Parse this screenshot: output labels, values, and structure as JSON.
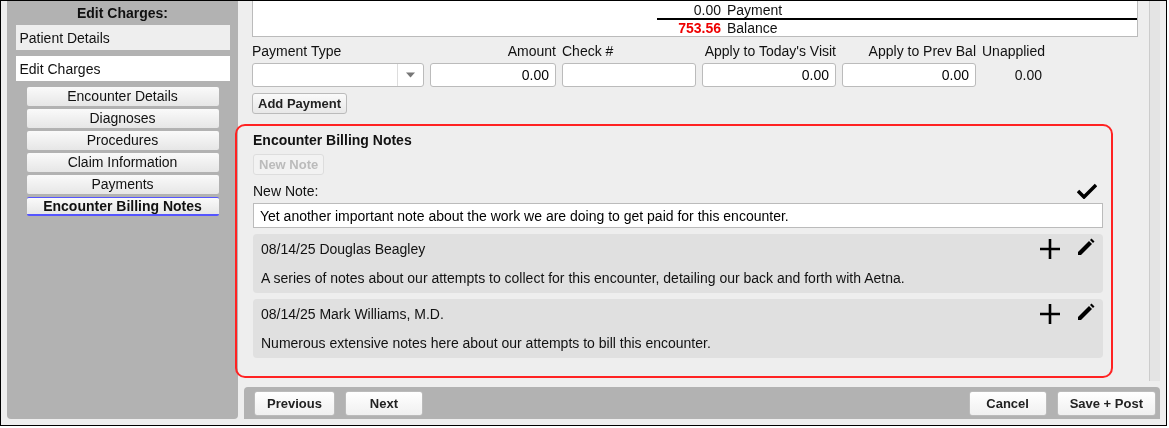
{
  "sidebar": {
    "title": "Edit Charges:",
    "items": [
      {
        "label": "Patient Details",
        "selected": false
      },
      {
        "label": "Edit Charges",
        "selected": true
      }
    ],
    "subitems": [
      {
        "label": "Encounter Details",
        "selected": false
      },
      {
        "label": "Diagnoses",
        "selected": false
      },
      {
        "label": "Procedures",
        "selected": false
      },
      {
        "label": "Claim Information",
        "selected": false
      },
      {
        "label": "Payments",
        "selected": false
      },
      {
        "label": "Encounter Billing Notes",
        "selected": true
      }
    ]
  },
  "summary": [
    {
      "amount": "0.00",
      "label": "Payment",
      "negative": false
    },
    {
      "amount": "753.56",
      "label": "Balance",
      "negative": true
    }
  ],
  "payment_form": {
    "fields": [
      {
        "kind": "select",
        "label": "Payment Type"
      },
      {
        "kind": "input",
        "label": "Amount",
        "value": "0.00"
      },
      {
        "kind": "text",
        "label": "Check #"
      },
      {
        "kind": "input",
        "label": "Apply to Today's Visit",
        "value": "0.00"
      },
      {
        "kind": "input",
        "label": "Apply to Prev Bal",
        "value": "0.00"
      },
      {
        "kind": "static",
        "label": "Unapplied",
        "value": "0.00"
      }
    ],
    "button": "Add Payment"
  },
  "billing_notes": {
    "title": "Encounter Billing Notes",
    "new_note_button": {
      "label": "New Note",
      "disabled": true
    },
    "new_note_label": "New Note:",
    "new_note_value": "Yet another important note about the work we are doing to get paid for this encounter.",
    "notes": [
      {
        "header": "08/14/25 Douglas Beagley",
        "text": "A series of notes about our attempts to collect for this encounter, detailing our back and forth with Aetna."
      },
      {
        "header": "08/14/25 Mark Williams, M.D.",
        "text": "Numerous extensive notes here about our attempts to bill this encounter."
      }
    ]
  },
  "footer": {
    "left": [
      "Previous",
      "Next"
    ],
    "right": [
      "Cancel",
      "Save + Post"
    ]
  }
}
